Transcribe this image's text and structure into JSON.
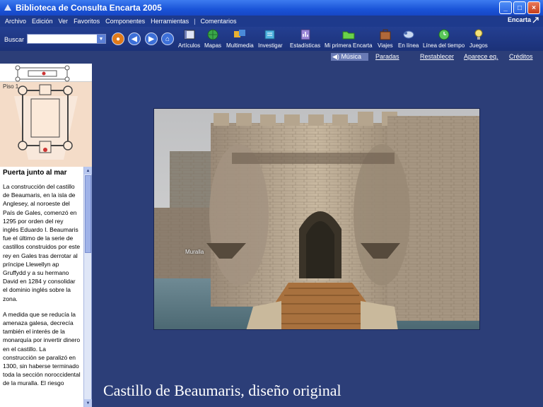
{
  "window": {
    "title": "Biblioteca de Consulta Encarta 2005"
  },
  "menu": [
    "Archivo",
    "Edición",
    "Ver",
    "Favoritos",
    "Componentes",
    "Herramientas",
    "Comentarios"
  ],
  "menu_separator": "|",
  "brand": "Encarta",
  "toolbar": {
    "search_label": "Buscar",
    "search_value": "",
    "tools": [
      "Artículos",
      "Mapas",
      "Multimedia",
      "Investigar",
      "Estadísticas",
      "Mi primera Encarta",
      "Viajes",
      "En línea",
      "Línea del tiempo",
      "Juegos"
    ]
  },
  "subbar": {
    "music": "Música",
    "stop": "Paradas",
    "reset": "Restablecer",
    "zoom": "Aparece eq.",
    "credits": "Créditos"
  },
  "left": {
    "floor_label": "Piso 1",
    "article_title": "Puerta junto al mar",
    "paragraphs": [
      "La construcción del castillo de Beaumaris, en la isla de Anglesey, al noroeste del País de Gales, comenzó en 1295 por orden del rey inglés Eduardo I. Beaumaris fue el último de la serie de castillos construidos por este rey en Gales tras derrotar al príncipe Llewellyn ap Gruffydd y a su hermano David en 1284 y consolidar el dominio inglés sobre la zona.",
      "A medida que se reducía la amenaza galesa, decrecía también el interés de la monarquía por invertir dinero en el castillo. La construcción se paralizó en 1300, sin haberse terminado toda la sección noroccidental de la muralla. El riesgo"
    ]
  },
  "main": {
    "hotspot_label": "Muralla",
    "caption": "Castillo de Beaumaris, diseño original"
  }
}
